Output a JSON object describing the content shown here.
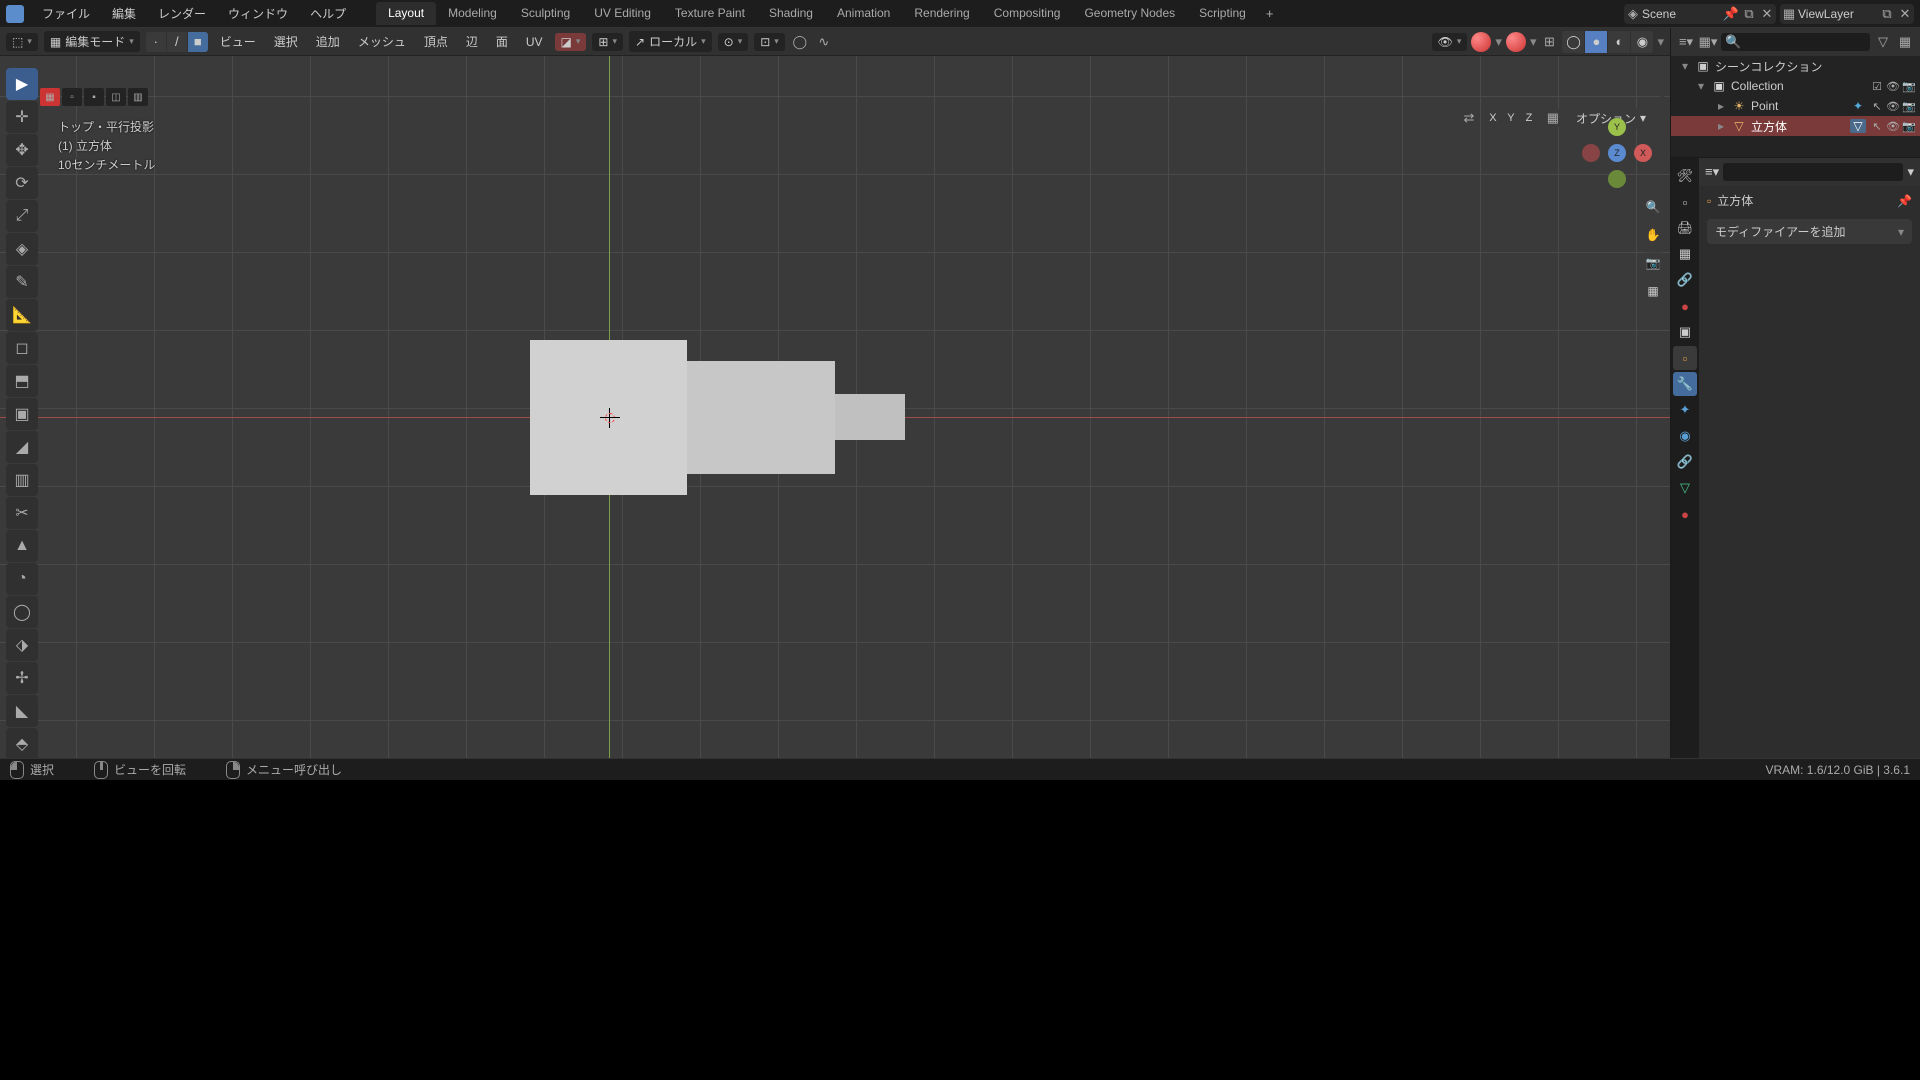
{
  "top_menu": {
    "file": "ファイル",
    "edit": "編集",
    "render": "レンダー",
    "window": "ウィンドウ",
    "help": "ヘルプ"
  },
  "workspaces": {
    "layout": "Layout",
    "modeling": "Modeling",
    "sculpting": "Sculpting",
    "uv": "UV Editing",
    "texture": "Texture Paint",
    "shading": "Shading",
    "animation": "Animation",
    "rendering": "Rendering",
    "compositing": "Compositing",
    "geo": "Geometry Nodes",
    "scripting": "Scripting"
  },
  "scene_name": "Scene",
  "view_layer": "ViewLayer",
  "mode": "編集モード",
  "vh_menus": {
    "view": "ビュー",
    "select": "選択",
    "add": "追加",
    "mesh": "メッシュ",
    "vertex": "頂点",
    "edge": "辺",
    "face": "面",
    "uv": "UV"
  },
  "orientation": "ローカル",
  "vp_info": {
    "view": "トップ・平行投影",
    "obj": "(1) 立方体",
    "scale": "10センチメートル"
  },
  "axes": {
    "x": "X",
    "y": "Y",
    "z": "Z"
  },
  "options_btn": "オプション",
  "outliner": {
    "root": "シーンコレクション",
    "collection": "Collection",
    "point": "Point",
    "cube": "立方体"
  },
  "props": {
    "crumb": "立方体",
    "addmod": "モディファイアーを追加"
  },
  "status": {
    "select": "選択",
    "rotate": "ビューを回転",
    "menu": "メニュー呼び出し",
    "vram": "VRAM: 1.6/12.0 GiB | 3.6.1"
  }
}
